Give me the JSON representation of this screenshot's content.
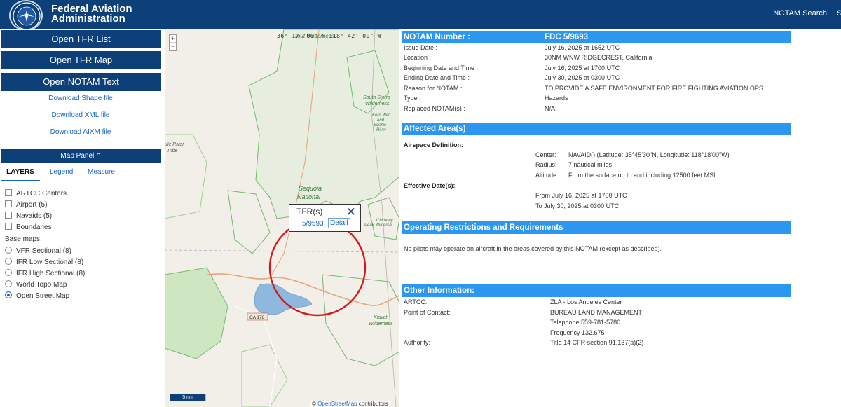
{
  "header": {
    "logo_alt": "FAA seal",
    "title_line1": "Federal Aviation",
    "title_line2": "Administration",
    "nav_notam_search": "NOTAM Search",
    "nav_cut": "S"
  },
  "sidebar": {
    "open_tfr_list": "Open TFR List",
    "open_tfr_map": "Open TFR Map",
    "open_notam_text": "Open NOTAM Text",
    "download_shape": "Download Shape file",
    "download_xml": "Download XML file",
    "download_aixm": "Download AIXM file",
    "map_panel": "Map Panel",
    "tabs": [
      "LAYERS",
      "Legend",
      "Measure"
    ],
    "layers": [
      {
        "label": "ARTCC Centers",
        "checked": false
      },
      {
        "label": "Airport (5)",
        "checked": false
      },
      {
        "label": "Navaids (5)",
        "checked": false
      },
      {
        "label": "Boundaries",
        "checked": false
      }
    ],
    "base_maps_label": "Base maps:",
    "base_maps": [
      {
        "label": "VFR Sectional (8)",
        "selected": false
      },
      {
        "label": "IFR Low Sectional (8)",
        "selected": false
      },
      {
        "label": "IFR High Sectional (8)",
        "selected": false
      },
      {
        "label": "World Topo Map",
        "selected": false
      },
      {
        "label": "Open Street Map",
        "selected": true
      }
    ]
  },
  "map": {
    "zoom_in": "+",
    "zoom_out": "−",
    "coordinate_readout": "36° 17' 00\" N  118° 42' 00\" W",
    "labels": {
      "trout_wilderness": "Trout Wilderness",
      "south_sierra": [
        "South Sierra",
        "Wilderness"
      ],
      "kern_wild": [
        "Kern Wild",
        "and",
        "Scenic",
        "River"
      ],
      "river_tribe": [
        "ule River",
        "Tribe"
      ],
      "sequoia": [
        "Sequoia",
        "National"
      ],
      "chimney_peak": [
        "Chimney",
        "Peak Wilderne"
      ],
      "kiavah": [
        "Kiavah",
        "Wilderness"
      ],
      "ca178": "CA 178"
    },
    "popup": {
      "title": "TFR(s)",
      "notam_id": "5/9593",
      "detail_link": "Detail",
      "close_glyph": "✕"
    },
    "scale": "5 nm",
    "attribution_prefix": "©",
    "attribution_link": "OpenStreetMap",
    "attribution_suffix": "contributors",
    "colors": {
      "tfr_circle": "#d0191b",
      "park_outline": "#74b96d",
      "park_fill": "#cfe6c2",
      "lake": "#8fb8de",
      "road": "#e5a77b"
    }
  },
  "notam": {
    "number_label": "NOTAM Number :",
    "number_value": "FDC 5/9693",
    "rows": [
      {
        "label": "Issue Date :",
        "value": "July 16, 2025 at 1652 UTC"
      },
      {
        "label": "Location :",
        "value": "30NM WNW RIDGECREST, California"
      },
      {
        "label": "Beginning Date and Time :",
        "value": "July 16, 2025 at 1700 UTC"
      },
      {
        "label": "Ending Date and Time :",
        "value": "July 30, 2025 at 0300 UTC"
      },
      {
        "label": "Reason for NOTAM :",
        "value": "TO PROVIDE A SAFE ENVIRONMENT FOR FIRE FIGHTING AVIATION OPS"
      },
      {
        "label": "Type :",
        "value": "Hazards"
      },
      {
        "label": "Replaced NOTAM(s) :",
        "value": "N/A"
      }
    ],
    "affected_area": {
      "heading": "Affected Area(s)",
      "airspace_definition_label": "Airspace Definition:",
      "center_key": "Center:",
      "center_val": "NAVAID() (Latitude: 35°45'30\"N, Longitude: 118°18'00\"W)",
      "radius_key": "Radius:",
      "radius_val": "7 nautical miles",
      "altitude_key": "Altitude:",
      "altitude_val": "From the surface up to and including 12500 feet MSL",
      "effective_dates_label": "Effective Date(s):",
      "from": "From July 16, 2025 at 1700 UTC",
      "to": "To July 30, 2025 at 0300 UTC"
    },
    "operating_restrictions": {
      "heading": "Operating Restrictions and Requirements",
      "text": "No pilots may operate an aircraft in the areas covered by this NOTAM (except as described)."
    },
    "other_info": {
      "heading": "Other Information:",
      "artcc_label": "ARTCC:",
      "artcc_value": "ZLA - Los Angeles Center",
      "poc_label": "Point of Contact:",
      "poc_name": "BUREAU LAND MANAGEMENT",
      "poc_phone": "Telephone 559-781-5780",
      "poc_freq": "Frequency 132.675",
      "authority_label": "Authority:",
      "authority_value": "Title 14 CFR section 91.137(a)(2)"
    }
  }
}
